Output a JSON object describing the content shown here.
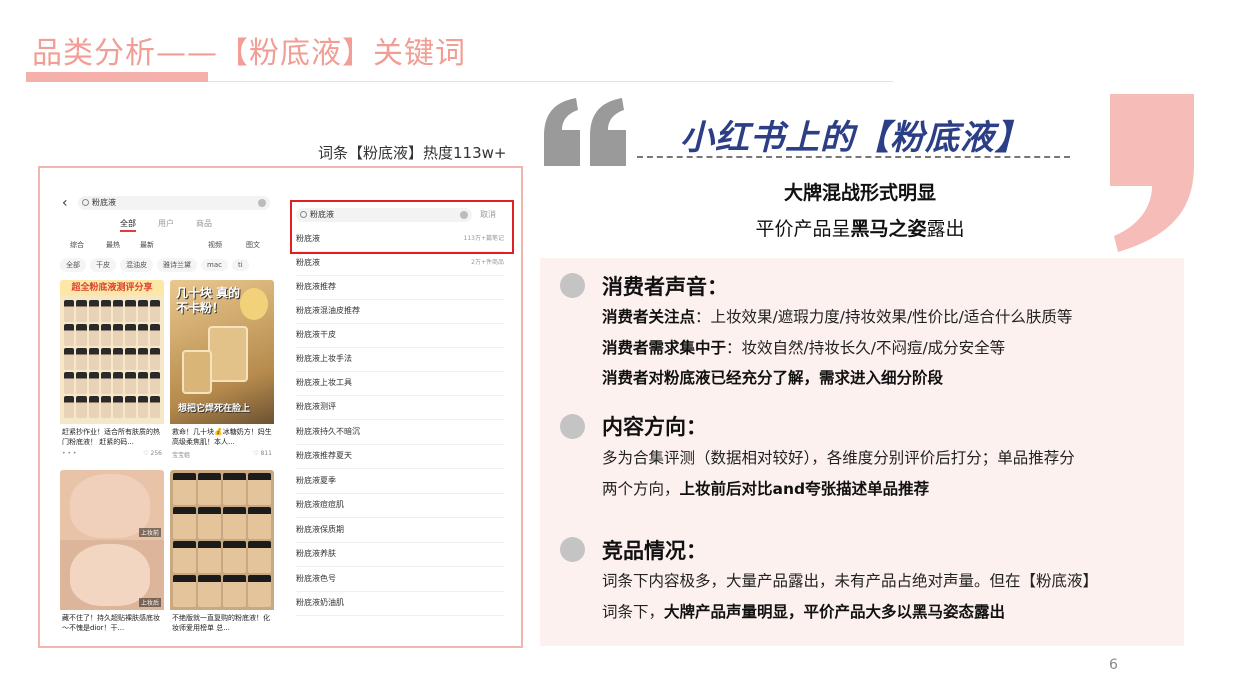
{
  "slide": {
    "title": "品类分析——【粉底液】关键词",
    "page_number": "6"
  },
  "screenshot": {
    "caption": "词条【粉底液】热度113w+",
    "left_phone": {
      "search_query": "粉底液",
      "tabs": [
        "全部",
        "用户",
        "商品"
      ],
      "filters": [
        "综合",
        "最热",
        "最新",
        "视频",
        "图文"
      ],
      "chips": [
        "全部",
        "干皮",
        "混油皮",
        "雅诗兰黛",
        "mac",
        "ti"
      ],
      "cards": [
        {
          "banner": "超全粉底液测评分享",
          "title": "赶紧抄作业！适合所有肤质的热门粉底液！ 赶紧的码...",
          "author": "• • •",
          "likes": "♡ 256"
        },
        {
          "headline": "几十块 真的不卡粉！",
          "footer": "想把它焊死在脸上",
          "title": "救命！几十块💰冰糖奶方！妈生高级柔焦肌！本人...",
          "author": "宝宝姐",
          "likes": "♡ 811"
        },
        {
          "label_top": "上妆前",
          "label_bottom": "上妆后",
          "title": "藏不住了！持久超贴裸肤感底妆～不愧是dior！干..."
        },
        {
          "title": "不绝版就一直复购的粉底液！化妆师爱用榜单 总..."
        }
      ]
    },
    "right_phone": {
      "search_query": "粉底液",
      "cancel_label": "取消",
      "suggestions": [
        {
          "text": "粉底液",
          "count": "113万+篇笔记"
        },
        {
          "text": "粉底液",
          "count": "2万+件商品"
        },
        {
          "text": "粉底液推荐",
          "count": ""
        },
        {
          "text": "粉底液混油皮推荐",
          "count": ""
        },
        {
          "text": "粉底液干皮",
          "count": ""
        },
        {
          "text": "粉底液上妆手法",
          "count": ""
        },
        {
          "text": "粉底液上妆工具",
          "count": ""
        },
        {
          "text": "粉底液测评",
          "count": ""
        },
        {
          "text": "粉底液持久不暗沉",
          "count": ""
        },
        {
          "text": "粉底液推荐夏天",
          "count": ""
        },
        {
          "text": "粉底液夏季",
          "count": ""
        },
        {
          "text": "粉底液痘痘肌",
          "count": ""
        },
        {
          "text": "粉底液保质期",
          "count": ""
        },
        {
          "text": "粉底液养肤",
          "count": ""
        },
        {
          "text": "粉底液色号",
          "count": ""
        },
        {
          "text": "粉底液奶油肌",
          "count": ""
        }
      ]
    }
  },
  "summary": {
    "heading": "小红书上的【粉底液】",
    "line1": "大牌混战形式明显",
    "line2_prefix": "平价产品呈",
    "line2_bold": "黑马之姿",
    "line2_suffix": "露出"
  },
  "sections": [
    {
      "title": "消费者声音：",
      "lines": [
        {
          "bold": "消费者关注点",
          "text": "：上妆效果/遮瑕力度/持妆效果/性价比/适合什么肤质等"
        },
        {
          "bold": "消费者需求集中于",
          "text": "：妆效自然/持妆长久/不闷痘/成分安全等"
        },
        {
          "bold": "消费者对粉底液已经充分了解，需求进入细分阶段",
          "text": ""
        }
      ]
    },
    {
      "title": "内容方向：",
      "lines": [
        {
          "text": "多为合集评测（数据相对较好），各维度分别评价后打分；单品推荐分"
        },
        {
          "text": "两个方向，",
          "bold_after": "上妆前后对比and夸张描述单品推荐"
        }
      ]
    },
    {
      "title": "竞品情况：",
      "lines": [
        {
          "text": "词条下内容极多，大量产品露出，未有产品占绝对声量。但在【粉底液】"
        },
        {
          "text": "词条下，",
          "bold_after": "大牌产品声量明显，平价产品大多以黑马姿态露出"
        }
      ]
    }
  ],
  "colors": {
    "title_pink": "#f29d95",
    "accent_bar": "#f4b1ab",
    "panel_bg": "#fdf1f0",
    "heading_navy": "#2c3e86",
    "highlight_red": "#e02020",
    "quote_gray": "#9a9a9a",
    "quote_pink": "#f6bcb7"
  }
}
